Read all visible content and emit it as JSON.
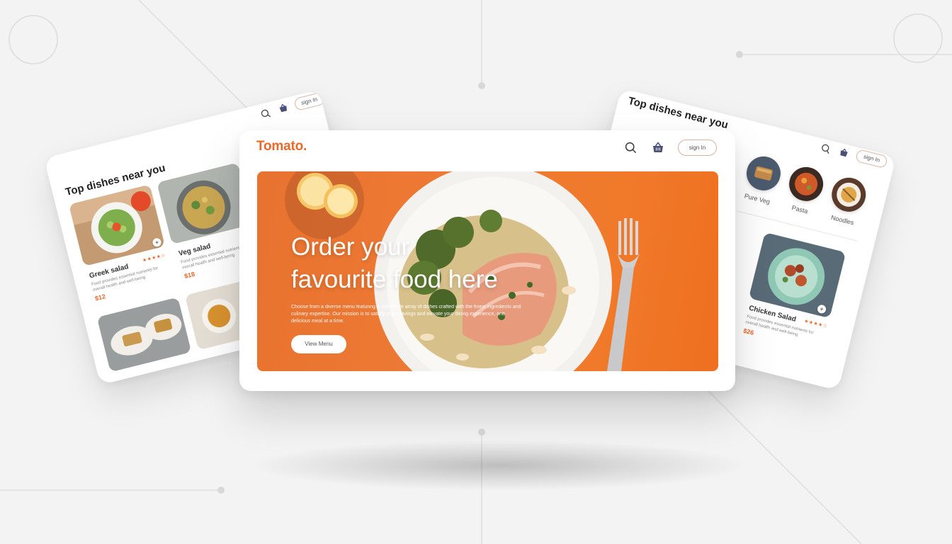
{
  "brand": {
    "logo": "Tomato.",
    "accent": "#e8692c"
  },
  "header": {
    "sign_in_label": "sign In",
    "search_icon": "search-icon",
    "basket_icon": "basket-icon"
  },
  "hero": {
    "title_line1": "Order your",
    "title_line2": "favourite food here",
    "description": "Choose from a diverse menu featuring a delectable array of dishes crafted with the finest ingredients and culinary expertise. Our mission is to satisfy your cravings and elevate your dining experience, one delicious meal at a time.",
    "button_label": "View Menu"
  },
  "left_preview": {
    "title": "Top dishes near you",
    "sign_in_label": "sign In",
    "dishes": [
      {
        "name": "Greek salad",
        "description": "Food provides essential nutrients for overall health and well-being",
        "price": "$12"
      },
      {
        "name": "Veg salad",
        "description": "Food provides essential nutrients for overall health and well-being",
        "price": "$18"
      }
    ]
  },
  "right_preview": {
    "title": "Top dishes near you",
    "sign_in_label": "sign In",
    "categories": [
      "Pure Veg",
      "Pasta",
      "Noodles"
    ],
    "dish": {
      "name": "Chicken Salad",
      "description": "Food provides essential nutrients for overall health and well-being",
      "price": "$26"
    }
  }
}
